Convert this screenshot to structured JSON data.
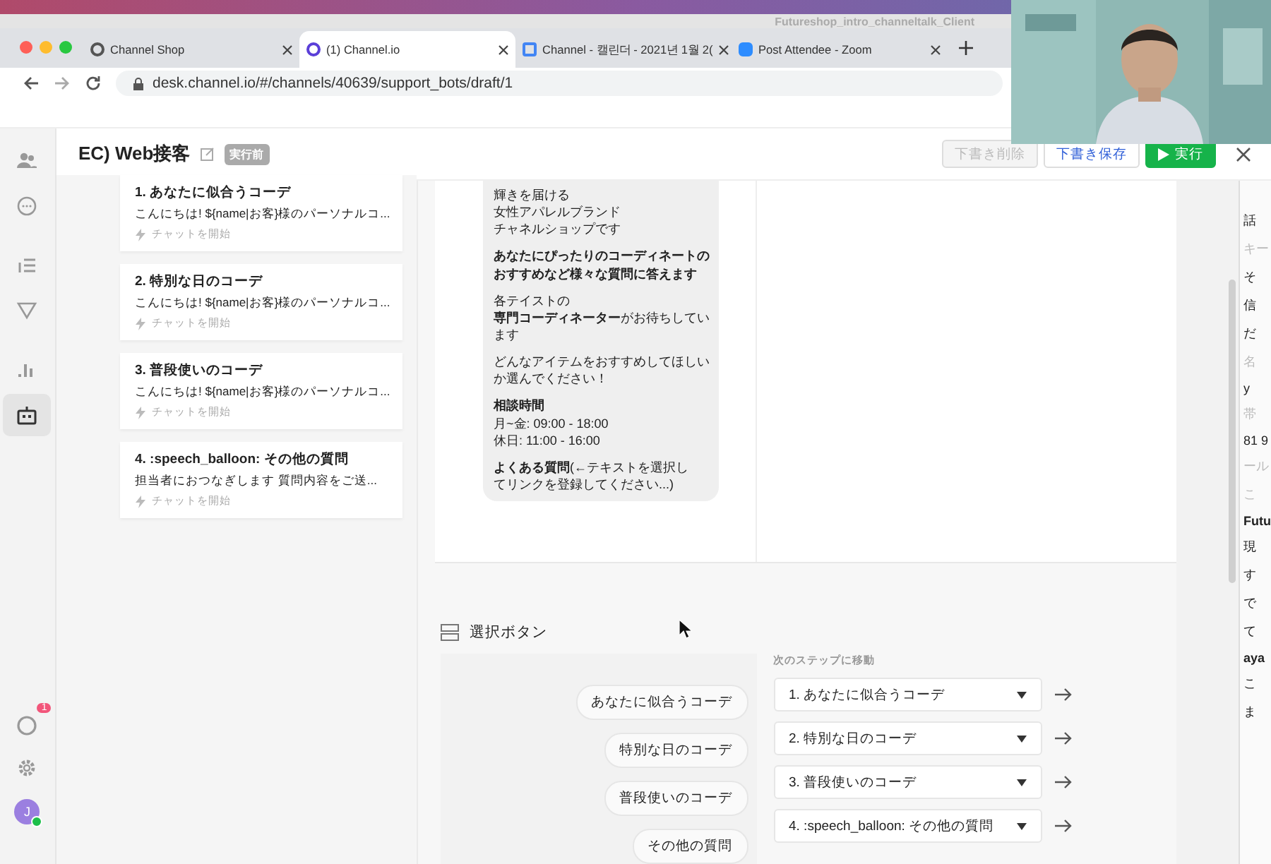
{
  "other_window_title": "Futureshop_intro_channeltalk_Client",
  "browser": {
    "tabs": [
      {
        "title": "Channel Shop",
        "selected": false
      },
      {
        "title": "(1) Channel.io",
        "selected": true
      },
      {
        "title": "Channel - 캘린더 - 2021년 1월 2(",
        "selected": false
      },
      {
        "title": "Post Attendee - Zoom",
        "selected": false
      }
    ],
    "url": "desk.channel.io/#/channels/40639/support_bots/draft/1"
  },
  "sidebar": {
    "items": [
      {
        "selected": false
      },
      {
        "selected": false
      },
      {
        "selected": false
      },
      {
        "selected": false
      },
      {
        "selected": false
      },
      {
        "selected": true
      }
    ],
    "notification_badge": "1",
    "avatar_initial": "J",
    "online": true
  },
  "header": {
    "title": "EC) Web接客",
    "status": "実行前",
    "buttons": [
      {
        "label": "下書き削除",
        "kind": "plain",
        "disabled": true
      },
      {
        "label": "下書き保存",
        "kind": "outline",
        "disabled": false
      },
      {
        "label": "実行",
        "kind": "primary",
        "disabled": false
      }
    ]
  },
  "steps": [
    {
      "title": "1.  あなたに似合うコーデ",
      "preview": "こんにちは! ${name|お客}様のパーソナルコ...",
      "action": "チャットを開始"
    },
    {
      "title": "2.  特別な日のコーデ",
      "preview": "こんにちは! ${name|お客}様のパーソナルコ...",
      "action": "チャットを開始"
    },
    {
      "title": "3.  普段使いのコーデ",
      "preview": "こんにちは! ${name|お客}様のパーソナルコ...",
      "action": "チャットを開始"
    },
    {
      "title": "4.  :speech_balloon: その他の質問",
      "preview": "担当者におつなぎします  質問内容をご送...",
      "action": "チャットを開始"
    }
  ],
  "message": {
    "paragraphs": [
      [
        "輝きを届ける",
        "女性アパレルブランド",
        "チャネルショップです"
      ],
      [
        "**あなたにぴったりのコーディネートの**",
        "**おすすめなど様々な質問に答えます**"
      ],
      [
        "各テイストの",
        "**専門コーディネーター**がお待ちしてい",
        "ます"
      ],
      [
        "どんなアイテムをおすすめしてほしい",
        "か選んでください！"
      ],
      [
        "**相談時間**",
        "月~金: 09:00 - 18:00",
        "休日: 11:00 - 16:00"
      ],
      [
        "**よくある質問**(←テキストを選択し",
        "てリンクを登録してください...)"
      ]
    ]
  },
  "choice_section": {
    "title": "選択ボタン",
    "next_step_label": "次のステップに移動",
    "choices": [
      {
        "label": "あなたに似合うコーデ",
        "target": "1. あなたに似合うコーデ"
      },
      {
        "label": "特別な日のコーデ",
        "target": "2. 特別な日のコーデ"
      },
      {
        "label": "普段使いのコーデ",
        "target": "3. 普段使いのコーデ"
      },
      {
        "label": "その他の質問",
        "target": "4. :speech_balloon: その他の質問"
      }
    ]
  },
  "right_panel": {
    "fragments": [
      {
        "text": "話",
        "kind": "text"
      },
      {
        "text": "キー",
        "kind": "muted"
      },
      {
        "text": "そ",
        "kind": "text"
      },
      {
        "text": "信",
        "kind": "text"
      },
      {
        "text": "だ",
        "kind": "text"
      },
      {
        "text": "名",
        "kind": "muted"
      },
      {
        "text": "y",
        "kind": "text"
      },
      {
        "text": "帯",
        "kind": "muted"
      },
      {
        "text": "81 9",
        "kind": "text"
      },
      {
        "text": "ール",
        "kind": "muted"
      },
      {
        "text": "こ",
        "kind": "muted"
      },
      {
        "text": "Futu",
        "kind": "bold"
      },
      {
        "text": "現",
        "kind": "text"
      },
      {
        "text": "す",
        "kind": "text"
      },
      {
        "text": "で",
        "kind": "text"
      },
      {
        "text": "て",
        "kind": "text"
      },
      {
        "text": "aya",
        "kind": "bold"
      },
      {
        "text": "こ",
        "kind": "text"
      },
      {
        "text": "ま",
        "kind": "text"
      }
    ]
  }
}
